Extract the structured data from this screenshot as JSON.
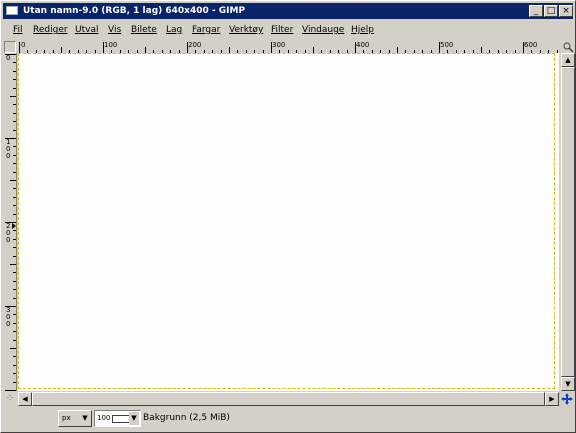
{
  "window": {
    "title": "Utan namn-9.0 (RGB, 1 lag) 640x400 - GIMP",
    "controls": {
      "minimize": "_",
      "maximize": "□",
      "close": "×"
    }
  },
  "menu": {
    "items": [
      {
        "label": "Fil"
      },
      {
        "label": "Rediger"
      },
      {
        "label": "Utval"
      },
      {
        "label": "Vis"
      },
      {
        "label": "Bilete"
      },
      {
        "label": "Lag"
      },
      {
        "label": "Fargar"
      },
      {
        "label": "Verktøy"
      },
      {
        "label": "Filter"
      },
      {
        "label": "Vindauge"
      },
      {
        "label": "Hjelp"
      }
    ]
  },
  "rulers": {
    "horizontal_labels": [
      "0",
      "100",
      "200",
      "300",
      "400",
      "500",
      "600"
    ],
    "vertical_labels": [
      "0",
      "100",
      "200",
      "300"
    ]
  },
  "statusbar": {
    "unit": "px",
    "zoom": "100",
    "layer_info": "Bakgrunn (2,5 MiB)"
  },
  "icons": {
    "navigate": "navigate-icon",
    "quick_mask": "quick-mask-icon",
    "move": "move-icon"
  }
}
